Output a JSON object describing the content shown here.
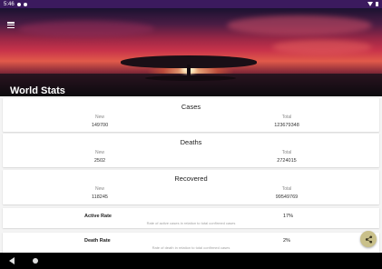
{
  "status_bar": {
    "time": "5:46"
  },
  "header": {
    "title": "World Stats"
  },
  "cards": [
    {
      "title": "Cases",
      "new_label": "New",
      "new_value": "149700",
      "total_label": "Total",
      "total_value": "123679348"
    },
    {
      "title": "Deaths",
      "new_label": "New",
      "new_value": "2502",
      "total_label": "Total",
      "total_value": "2724015"
    },
    {
      "title": "Recovered",
      "new_label": "New",
      "new_value": "118245",
      "total_label": "Total",
      "total_value": "99549769"
    }
  ],
  "rates": [
    {
      "label": "Active Rate",
      "value": "17%",
      "description": "Rate of active cases in relation to total confirmed cases"
    },
    {
      "label": "Death Rate",
      "value": "2%",
      "description": "Rate of death in relation to total confirmed cases"
    }
  ],
  "icons": {
    "menu": "menu-icon",
    "share": "share-icon",
    "back": "back-icon",
    "home": "home-icon"
  }
}
